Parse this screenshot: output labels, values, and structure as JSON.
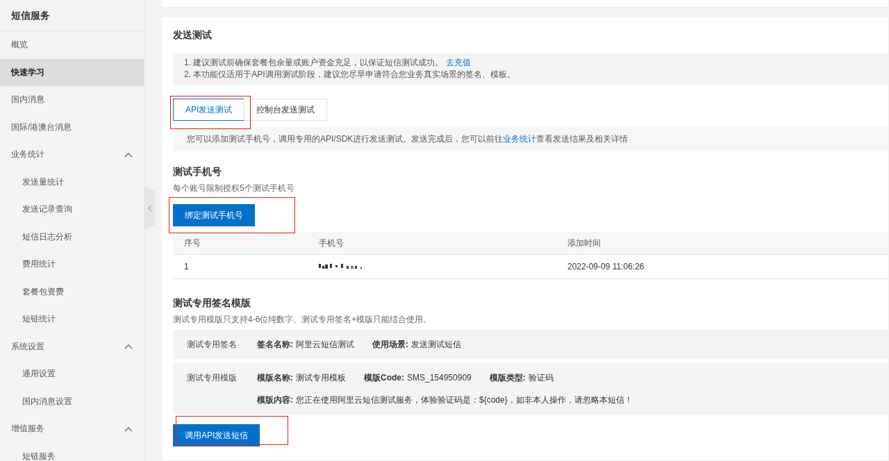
{
  "sidebar": {
    "title": "短信服务",
    "items": [
      {
        "label": "概览",
        "selected": false
      },
      {
        "label": "快速学习",
        "selected": true
      },
      {
        "label": "国内消息",
        "selected": false
      },
      {
        "label": "国际/港澳台消息",
        "selected": false
      },
      {
        "label": "业务统计",
        "selected": false,
        "expanded": true,
        "children": [
          {
            "label": "发送量统计",
            "selected": false
          },
          {
            "label": "发送记录查询",
            "selected": false
          },
          {
            "label": "短信日志分析",
            "selected": false
          },
          {
            "label": "费用统计",
            "selected": false
          },
          {
            "label": "套餐包资费",
            "selected": false
          },
          {
            "label": "短链统计",
            "selected": false
          }
        ]
      },
      {
        "label": "系统设置",
        "selected": false,
        "expanded": true,
        "children": [
          {
            "label": "通用设置",
            "selected": false
          },
          {
            "label": "国内消息设置",
            "selected": false
          }
        ]
      },
      {
        "label": "增值服务",
        "selected": false,
        "expanded": true,
        "children": [
          {
            "label": "短链服务",
            "selected": false
          }
        ]
      }
    ]
  },
  "send_test": {
    "title": "发送测试",
    "notices": [
      {
        "text": "1. 建议测试前确保套餐包余量或账户资金充足，以保证短信测试成功。",
        "link": "去充值"
      },
      {
        "text": "2. 本功能仅适用于API调用测试阶段，建议您尽早申请符合您业务真实场景的签名、模板。"
      }
    ],
    "tabs_highlighted": true,
    "tabs": [
      {
        "label": "API发送测试",
        "selected": true
      },
      {
        "label": "控制台发送测试",
        "selected": false
      }
    ],
    "tab_description": {
      "before": "您可以添加测试手机号，调用专用的API/SDK进行发送测试。发送完成后，您可以前往",
      "link": "业务统计",
      "after": "查看发送结果及相关详情"
    }
  },
  "test_phones": {
    "title": "测试手机号",
    "subtitle": "每个账号限制授权5个测试手机号",
    "bind_button": {
      "label": "绑定测试手机号",
      "highlighted": true
    },
    "columns": [
      "序号",
      "手机号",
      "添加时间"
    ],
    "rows": [
      {
        "index": "1",
        "phone_redacted": true,
        "added": "2022-09-09 11:06:26"
      }
    ]
  },
  "test_templates": {
    "title": "测试专用签名模版",
    "subtitle": "测试专用模版只支持4-6位纯数字、测试专用签名+模版只能结合使用。",
    "rows": [
      {
        "label": "测试专用签名",
        "lines": [
          [
            {
              "key": "签名名称:",
              "value": "阿里云短信测试"
            },
            {
              "key": "使用场景:",
              "value": "发送测试短信"
            }
          ]
        ]
      },
      {
        "label": "测试专用模版",
        "lines": [
          [
            {
              "key": "模版名称:",
              "value": "测试专用模板"
            },
            {
              "key": "模版Code:",
              "value": "SMS_154950909"
            },
            {
              "key": "模版类型:",
              "value": "验证码"
            }
          ],
          [
            {
              "key": "模版内容:",
              "value": "您正在使用阿里云短信测试服务，体验验证码是：${code}，如非本人操作，请忽略本短信！"
            }
          ]
        ]
      }
    ],
    "send_button": {
      "label": "调用API发送短信",
      "highlighted": true
    }
  }
}
